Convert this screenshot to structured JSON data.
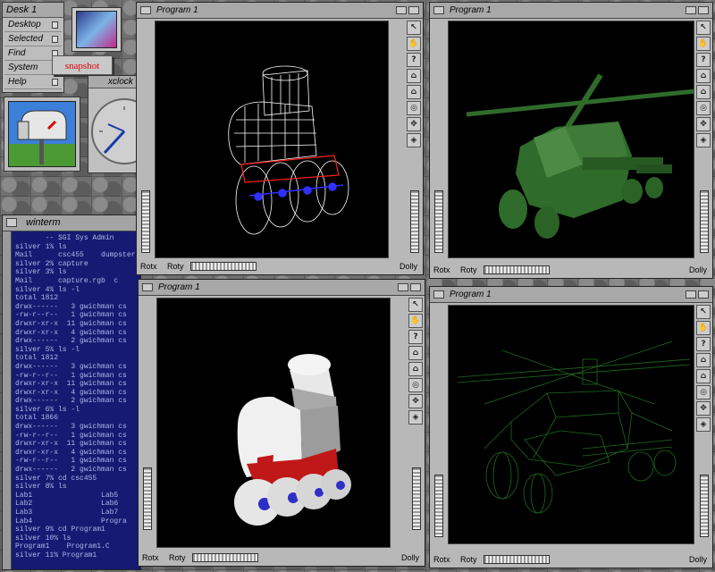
{
  "desk": {
    "title": "Desk 1",
    "items": [
      "Desktop",
      "Selected",
      "Find",
      "System",
      "Help"
    ],
    "snapshot_label": "snapshot"
  },
  "xclock": {
    "title": "xclock"
  },
  "winterm": {
    "title": "winterm",
    "lines": [
      "       -- SGI Sys Admin",
      "silver 1% ls",
      "Mail      csc455    dumpster",
      "silver 2% capture",
      "silver 3% ls",
      "Mail      capture.rgb  c",
      "silver 4% ls -l",
      "total 1812",
      "drwx------   3 gwichman cs",
      "-rw-r--r--   1 gwichman cs",
      "drwxr-xr-x  11 gwichman cs",
      "drwxr-xr-x   4 gwichman cs",
      "drwx------   2 gwichman cs",
      "silver 5% ls -l",
      "total 1812",
      "drwx------   3 gwichman cs",
      "-rw-r--r--   1 gwichman cs",
      "drwxr-xr-x  11 gwichman cs",
      "drwxr-xr-x   4 gwichman cs",
      "drwx------   2 gwichman cs",
      "silver 6% ls -l",
      "total 1866",
      "drwx------   3 gwichman cs",
      "-rw-r--r--   1 gwichman cs",
      "drwxr-xr-x  11 gwichman cs",
      "drwxr-xr-x   4 gwichman cs",
      "-rw-r--r--   1 gwichman cs",
      "drwx------   2 gwichman cs",
      "silver 7% cd csc455",
      "silver 8% ls",
      "Lab1                Lab5",
      "Lab2                Lab6",
      "Lab3                Lab7",
      "Lab4                Progra",
      "silver 9% cd Program1",
      "silver 10% ls",
      "Program1    Program1.C",
      "silver 11% Program1"
    ]
  },
  "program_windows": [
    {
      "title": "Program 1",
      "rotx": "Rotx",
      "roty": "Roty",
      "dolly": "Dolly"
    },
    {
      "title": "Program 1",
      "rotx": "Rotx",
      "roty": "Roty",
      "dolly": "Dolly"
    },
    {
      "title": "Program 1",
      "rotx": "Rotx",
      "roty": "Roty",
      "dolly": "Dolly"
    },
    {
      "title": "Program 1",
      "rotx": "Rotx",
      "roty": "Roty",
      "dolly": "Dolly"
    }
  ],
  "viewer_tools": [
    "arrow-icon",
    "hand-icon",
    "help-icon",
    "home-icon",
    "set-home-icon",
    "view-all-icon",
    "seek-icon",
    "projection-icon"
  ],
  "colors": {
    "terminal_bg": "#161a72",
    "terminal_fg": "#b3b8e9",
    "wire_white": "#ffffff",
    "wire_red": "#ff2020",
    "wire_blue": "#3030ff",
    "heli_green": "#2f6b2a",
    "skate_red": "#c01818"
  }
}
